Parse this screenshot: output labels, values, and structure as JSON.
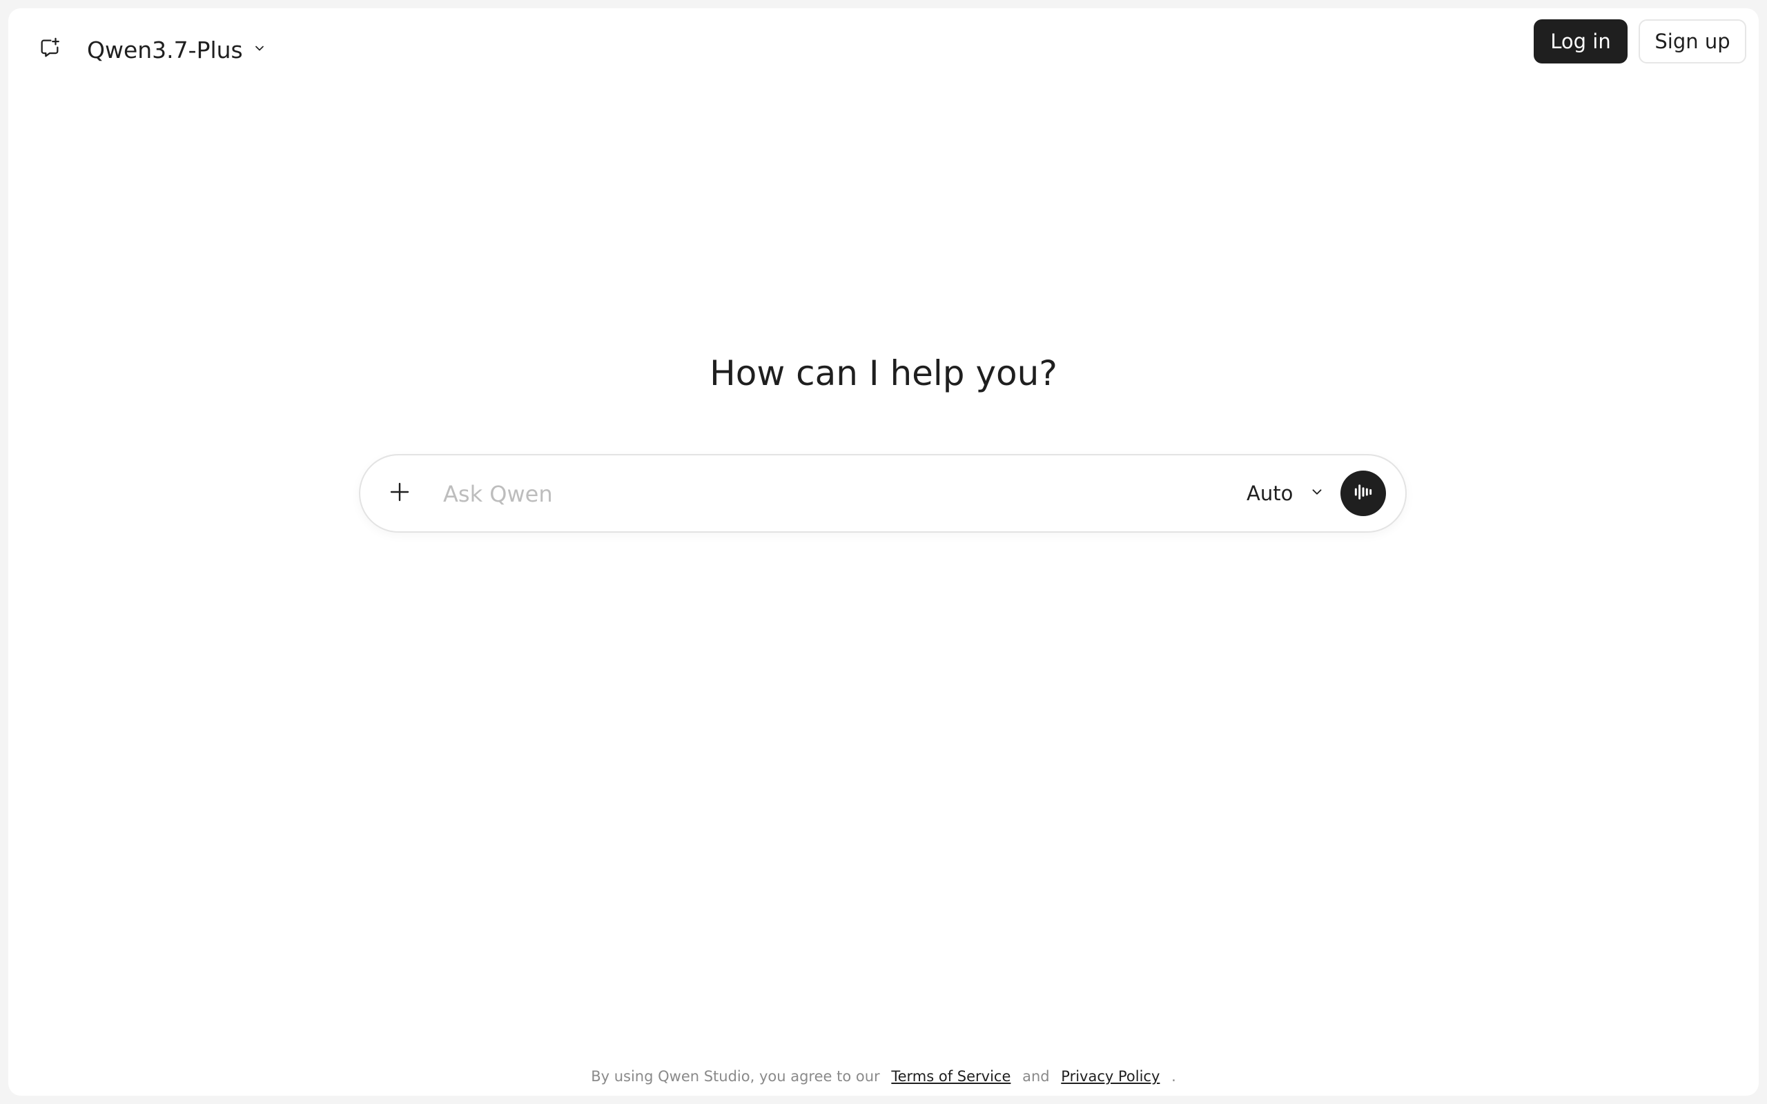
{
  "header": {
    "new_chat_icon": "new-chat-icon",
    "model_name": "Qwen3.7-Plus",
    "model_chevron_icon": "chevron-down-icon",
    "login_label": "Log in",
    "signup_label": "Sign up"
  },
  "main": {
    "title": "How can I help you?",
    "composer": {
      "attach_icon": "plus-icon",
      "placeholder": "Ask Qwen",
      "value": "",
      "mode_label": "Auto",
      "mode_chevron_icon": "chevron-down-icon",
      "voice_icon": "voice-waveform-icon"
    }
  },
  "footer": {
    "prefix": "By using Qwen Studio, you agree to our",
    "terms_label": "Terms of Service",
    "and_text": "and",
    "privacy_label": "Privacy Policy",
    "suffix": "."
  },
  "colors": {
    "primary_dark": "#1f1f1f",
    "border": "#e3e3e3",
    "placeholder": "#bdbdbd",
    "muted_text": "#8a8a8a"
  }
}
